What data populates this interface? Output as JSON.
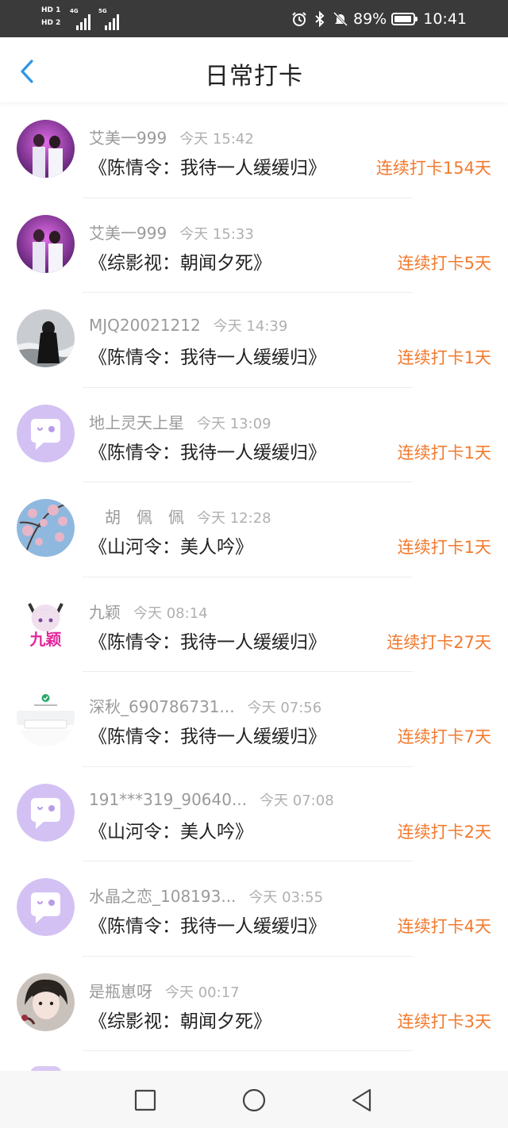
{
  "status_bar": {
    "hd1": "HD 1",
    "hd2": "HD 2",
    "net1": "4G",
    "net2": "5G",
    "battery_pct": "89%",
    "time": "10:41"
  },
  "header": {
    "title": "日常打卡"
  },
  "colors": {
    "accent_blue": "#2f95e6",
    "streak_orange": "#f27a2e",
    "placeholder_purple": "#d3c1f4"
  },
  "checkins": [
    {
      "name": "艾美一999",
      "time": "今天 15:42",
      "book": "《陈情令：我待一人缓缓归》",
      "streak": "连续打卡154天",
      "avatar": "photo-purple"
    },
    {
      "name": "艾美一999",
      "time": "今天 15:33",
      "book": "《综影视：朝闻夕死》",
      "streak": "连续打卡5天",
      "avatar": "photo-purple"
    },
    {
      "name": "MJQ20021212",
      "time": "今天 14:39",
      "book": "《陈情令：我待一人缓缓归》",
      "streak": "连续打卡1天",
      "avatar": "photo-gray"
    },
    {
      "name": "地上灵天上星",
      "time": "今天 13:09",
      "book": "《陈情令：我待一人缓缓归》",
      "streak": "连续打卡1天",
      "avatar": "default"
    },
    {
      "name": "　胡　佩　佩",
      "time": "今天 12:28",
      "book": "《山河令：美人吟》",
      "streak": "连续打卡1天",
      "avatar": "photo-blossom"
    },
    {
      "name": "九颖",
      "time": "今天 08:14",
      "book": "《陈情令：我待一人缓缓归》",
      "streak": "连续打卡27天",
      "avatar": "anime-pink"
    },
    {
      "name": "深秋_690786731...",
      "time": "今天 07:56",
      "book": "《陈情令：我待一人缓缓归》",
      "streak": "连续打卡7天",
      "avatar": "screenshot"
    },
    {
      "name": "191***319_90640...",
      "time": "今天 07:08",
      "book": "《山河令：美人吟》",
      "streak": "连续打卡2天",
      "avatar": "default"
    },
    {
      "name": "水晶之恋_108193...",
      "time": "今天 03:55",
      "book": "《陈情令：我待一人缓缓归》",
      "streak": "连续打卡4天",
      "avatar": "default"
    },
    {
      "name": "是瓶崽呀",
      "time": "今天 00:17",
      "book": "《综影视：朝闻夕死》",
      "streak": "连续打卡3天",
      "avatar": "anime-dark"
    }
  ],
  "nav": {
    "buttons": [
      "recents-square",
      "home-circle",
      "back-triangle"
    ]
  }
}
